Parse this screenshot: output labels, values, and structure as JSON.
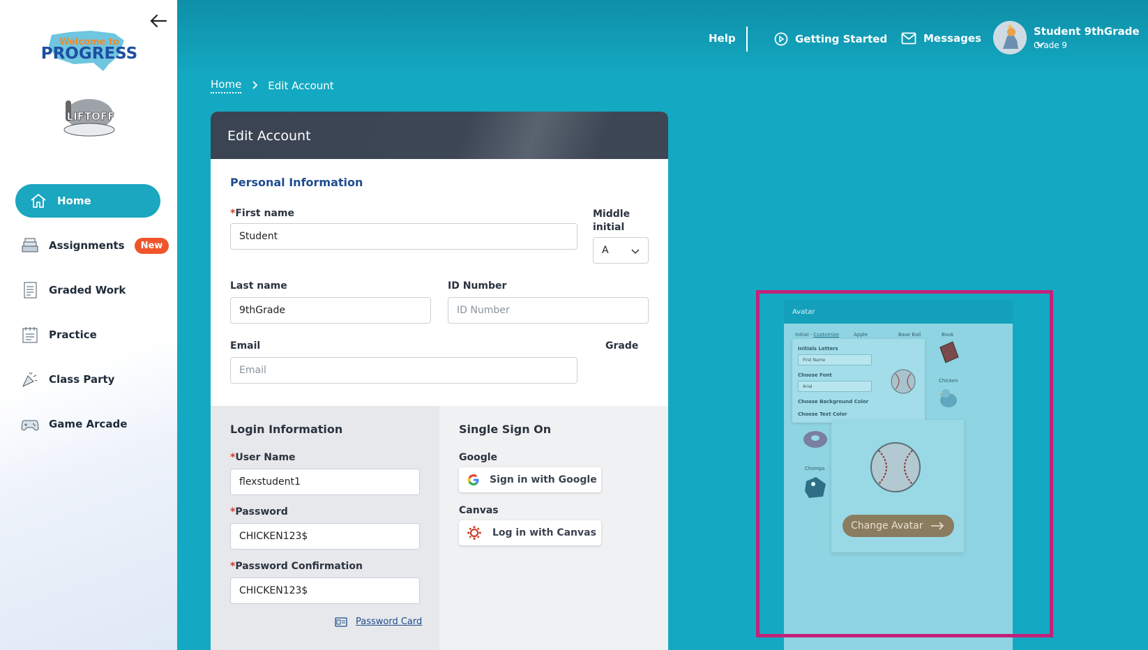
{
  "sidebar": {
    "logo_text": "Welcome to PROGRESS",
    "secondary_logo_text": "LIFTOFF",
    "items": [
      {
        "label": "Home",
        "icon": "home-icon",
        "active": true
      },
      {
        "label": "Assignments",
        "icon": "assignments-icon",
        "badge": "New"
      },
      {
        "label": "Graded Work",
        "icon": "graded-work-icon"
      },
      {
        "label": "Practice",
        "icon": "practice-icon"
      },
      {
        "label": "Class Party",
        "icon": "party-popper-icon"
      },
      {
        "label": "Game Arcade",
        "icon": "gamepad-icon"
      }
    ]
  },
  "header": {
    "help": "Help",
    "getting_started": "Getting Started",
    "messages": "Messages",
    "user_name": "Student 9thGrade",
    "user_grade": "Grade 9"
  },
  "breadcrumb": {
    "home": "Home",
    "current": "Edit Account"
  },
  "form": {
    "title": "Edit Account",
    "personal_title": "Personal Information",
    "first_name_label": "First name",
    "first_name_value": "Student",
    "middle_initial_label": "Middle initial",
    "middle_initial_value": "A",
    "last_name_label": "Last name",
    "last_name_value": "9thGrade",
    "id_label": "ID Number",
    "id_placeholder": "ID Number",
    "email_label": "Email",
    "email_placeholder": "Email",
    "grade_label": "Grade",
    "login_title": "Login Information",
    "username_label": "User Name",
    "username_value": "flexstudent1",
    "password_label": "Password",
    "password_value": "CHICKEN123$",
    "password_confirm_label": "Password Confirmation",
    "password_confirm_value": "CHICKEN123$",
    "password_card": "Password Card",
    "required_mark": "*",
    "sso_title": "Single Sign On",
    "google_label": "Google",
    "google_button": "Sign in with Google",
    "canvas_label": "Canvas",
    "canvas_button": "Log in with Canvas"
  },
  "avatar_preview": {
    "title": "Avatar",
    "tab_initial": "Initial -",
    "tab_customize": "Customize",
    "col_apple": "Apple",
    "col_baseball": "Base Ball",
    "col_book": "Book",
    "col_chicken": "Chicken",
    "col_chomps": "Chomps",
    "initials_label": "Initials Letters",
    "initials_value": "First Name",
    "font_label": "Choose Font",
    "font_value": "Arial",
    "bg_color_label": "Choose Background Color",
    "text_color_label": "Choose Text Color",
    "change_button": "Change Avatar",
    "highlight_color": "#c2227a"
  },
  "colors": {
    "accent": "#1aa7bf",
    "badge": "#f0542a",
    "header_dark": "#3d4654",
    "link": "#1f4c8f"
  }
}
